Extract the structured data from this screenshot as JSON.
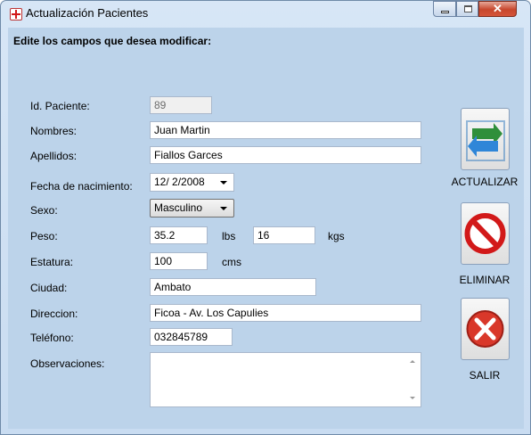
{
  "window": {
    "title": "Actualización Pacientes",
    "close_glyph": "✕"
  },
  "form": {
    "heading": "Edite los campos que desea modificar:",
    "fields": {
      "id_label": "Id. Paciente:",
      "id_value": "89",
      "nombres_label": "Nombres:",
      "nombres_value": "Juan Martin",
      "apellidos_label": "Apellidos:",
      "apellidos_value": "Fiallos Garces",
      "fecha_label": "Fecha de nacimiento:",
      "fecha_value": "12/ 2/2008",
      "sexo_label": "Sexo:",
      "sexo_value": "Masculino",
      "peso_label": "Peso:",
      "peso_lbs_value": "35.2",
      "peso_lbs_unit": "lbs",
      "peso_kgs_value": "16",
      "peso_kgs_unit": "kgs",
      "estatura_label": "Estatura:",
      "estatura_value": "100",
      "estatura_unit": "cms",
      "ciudad_label": "Ciudad:",
      "ciudad_value": "Ambato",
      "direccion_label": "Direccion:",
      "direccion_value": "Ficoa - Av. Los Capulies",
      "telefono_label": "Teléfono:",
      "telefono_value": "032845789",
      "observaciones_label": "Observaciones:",
      "observaciones_value": ""
    }
  },
  "actions": {
    "actualizar_label": "ACTUALIZAR",
    "eliminar_label": "ELIMINAR",
    "salir_label": "SALIR"
  },
  "icons": {
    "app": "red-cross-icon",
    "actualizar": "refresh-arrows-icon",
    "eliminar": "prohibited-icon",
    "salir": "red-x-icon"
  },
  "colors": {
    "client_bg": "#bcd3ea",
    "prohibit_red": "#d21919",
    "refresh_green": "#2f8f3a",
    "refresh_blue": "#2f86d8"
  }
}
